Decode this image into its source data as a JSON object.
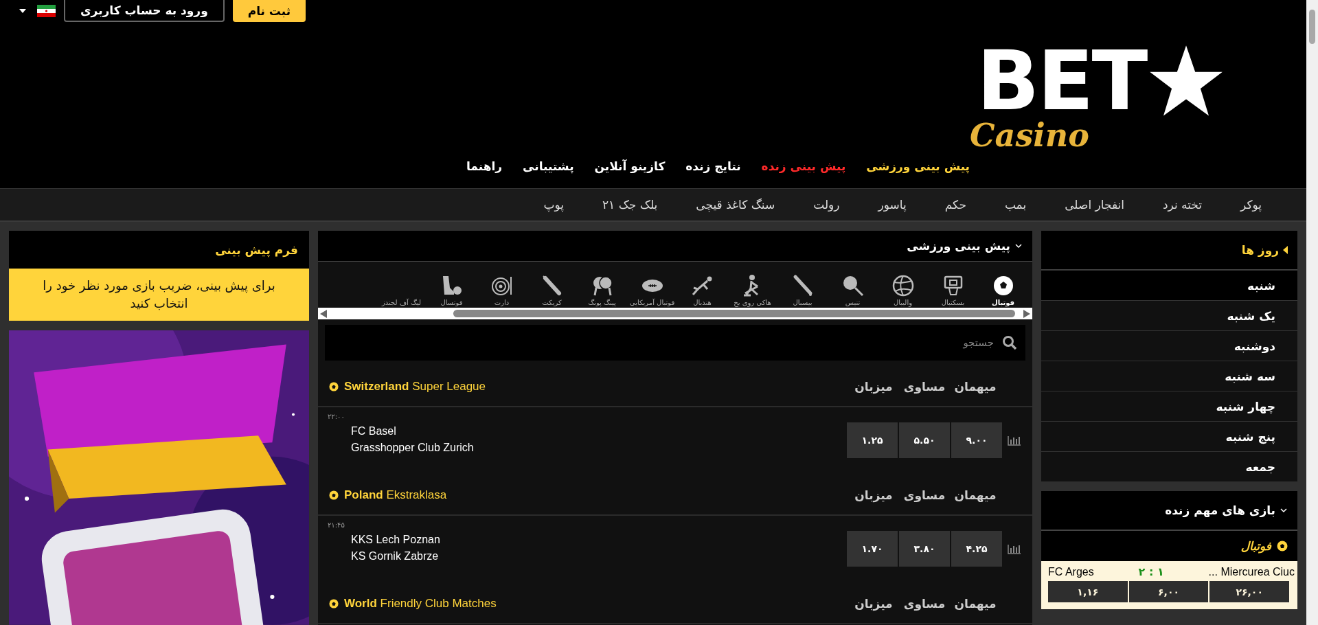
{
  "top_bar": {
    "login_button": "ورود به حساب کاربری",
    "register_button": "ثبت نام"
  },
  "logo": {
    "text": "BET",
    "subtitle": "Casino"
  },
  "main_nav": [
    {
      "label": "پیش بینی ورزشی",
      "color": "#ffd43b"
    },
    {
      "label": "پیش بینی زنده",
      "color": "#ff2a2a"
    },
    {
      "label": "نتایج زنده",
      "color": "#ffffff"
    },
    {
      "label": "کازینو آنلاین",
      "color": "#ffffff"
    },
    {
      "label": "پشتیبانی",
      "color": "#ffffff"
    },
    {
      "label": "راهنما",
      "color": "#ffffff"
    }
  ],
  "games_nav": [
    "پوکر",
    "تخته نرد",
    "انفجار اصلی",
    "بمب",
    "حکم",
    "پاسور",
    "رولت",
    "سنگ کاغذ قیچی",
    "بلک جک ۲۱",
    "پوپ"
  ],
  "days_panel": {
    "title": "روز ها",
    "items": [
      {
        "label": "شنبه",
        "selected": true
      },
      {
        "label": "یک شنبه",
        "selected": false
      },
      {
        "label": "دوشنبه",
        "selected": false
      },
      {
        "label": "سه شنبه",
        "selected": false
      },
      {
        "label": "چهار شنبه",
        "selected": false
      },
      {
        "label": "پنج شنبه",
        "selected": false
      },
      {
        "label": "جمعه",
        "selected": false
      }
    ]
  },
  "live_panel": {
    "title": "بازی های مهم زنده",
    "sport": "فوتبال",
    "matches": [
      {
        "home": "FC Arges",
        "score": "۲ : ۱",
        "away": "... Miercurea Ciuc",
        "odds": [
          "۲۶,۰۰",
          "۶,۰۰",
          "۱,۱۶"
        ]
      }
    ]
  },
  "sports_panel": {
    "title": "پیش بینی ورزشی",
    "sports": [
      {
        "label": "فوتبال",
        "selected": true
      },
      {
        "label": "بسکتبال",
        "selected": false
      },
      {
        "label": "والیبال",
        "selected": false
      },
      {
        "label": "تنیس",
        "selected": false
      },
      {
        "label": "بیسبال",
        "selected": false
      },
      {
        "label": "هاکی روی یخ",
        "selected": false
      },
      {
        "label": "هندبال",
        "selected": false
      },
      {
        "label": "فوتبال آمریکایی",
        "selected": false
      },
      {
        "label": "پینگ پونگ",
        "selected": false
      },
      {
        "label": "کریکت",
        "selected": false
      },
      {
        "label": "دارت",
        "selected": false
      },
      {
        "label": "فوتسال",
        "selected": false
      },
      {
        "label": "لیگ آف لجندز",
        "selected": false
      }
    ],
    "search": {
      "placeholder": "جستجو"
    },
    "leagues": [
      {
        "title": "**Switzerland** Super League",
        "columns": [
          "میهمان",
          "مساوی",
          "میزبان"
        ],
        "matches": [
          {
            "time": "۲۲:۰۰",
            "home": "FC Basel",
            "away": "Grasshopper Club Zurich",
            "odds": [
              "۹.۰۰",
              "۵.۵۰",
              "۱.۲۵"
            ]
          }
        ]
      },
      {
        "title": "**Poland** Ekstraklasa",
        "columns": [
          "میهمان",
          "مساوی",
          "میزبان"
        ],
        "matches": [
          {
            "time": "۲۱:۴۵",
            "home": "KKS Lech Poznan",
            "away": "KS Gornik Zabrze",
            "odds": [
              "۴.۲۵",
              "۳.۸۰",
              "۱.۷۰"
            ]
          }
        ]
      },
      {
        "title": "**World** Friendly Club Matches",
        "columns": [
          "میهمان",
          "مساوی",
          "میزبان"
        ]
      }
    ]
  },
  "bet_form": {
    "title": "فرم پیش بینی",
    "message": "برای پیش بینی، ضریب بازی مورد نظر خود را انتخاب کنید"
  }
}
